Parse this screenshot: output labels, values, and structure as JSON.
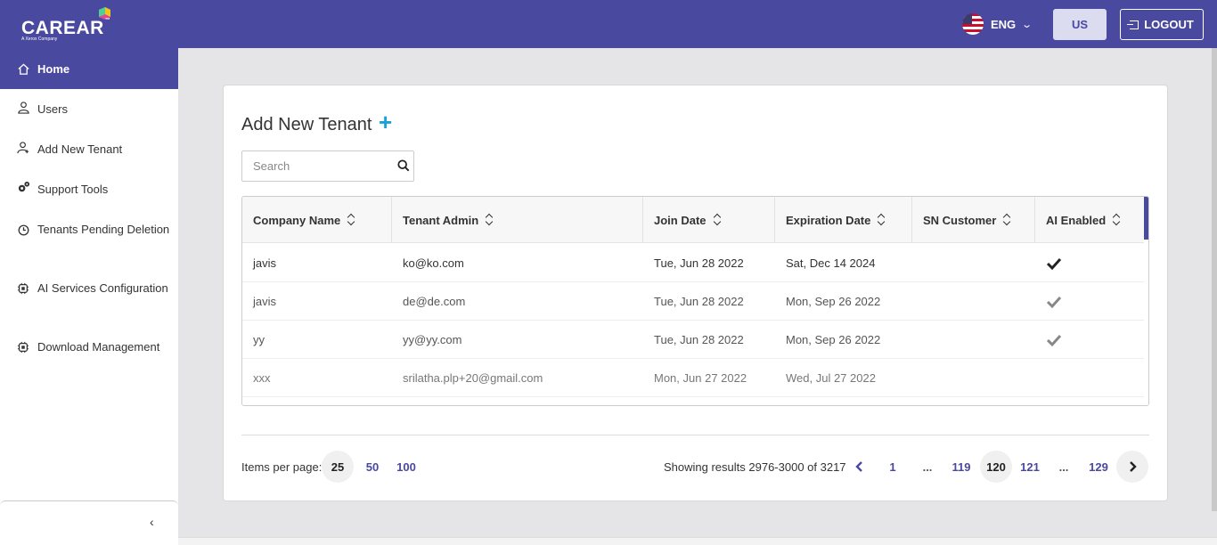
{
  "brand": {
    "name": "CAREAR",
    "tm": "™",
    "sub": "A Xerox Company"
  },
  "header": {
    "language": "ENG",
    "user_button": "US",
    "logout_label": "LOGOUT"
  },
  "sidebar": {
    "items": [
      {
        "label": "Home",
        "icon": "home-icon",
        "active": true
      },
      {
        "label": "Users",
        "icon": "user-icon"
      },
      {
        "label": "Add New Tenant",
        "icon": "user-add-icon"
      },
      {
        "label": "Support Tools",
        "icon": "gears-icon"
      },
      {
        "label": "Tenants Pending Deletion",
        "icon": "clock-icon"
      },
      {
        "label": "AI Services Configuration",
        "icon": "chip-icon"
      },
      {
        "label": "Download Management",
        "icon": "chip-icon"
      }
    ],
    "collapse_glyph": "‹"
  },
  "main": {
    "title": "Add New Tenant",
    "add_glyph": "+",
    "search_placeholder": "Search",
    "table": {
      "columns": [
        "Company Name",
        "Tenant Admin",
        "Join Date",
        "Expiration Date",
        "SN Customer",
        "AI Enabled"
      ],
      "rows": [
        {
          "company": "javis",
          "admin": "ko@ko.com",
          "join": "Tue, Jun 28 2022",
          "expiration": "Sat, Dec 14 2024",
          "sn": "",
          "ai": true
        },
        {
          "company": "javis",
          "admin": "de@de.com",
          "join": "Tue, Jun 28 2022",
          "expiration": "Mon, Sep 26 2022",
          "sn": "",
          "ai": true
        },
        {
          "company": "yy",
          "admin": "yy@yy.com",
          "join": "Tue, Jun 28 2022",
          "expiration": "Mon, Sep 26 2022",
          "sn": "",
          "ai": true
        },
        {
          "company": "xxx",
          "admin": "srilatha.plp+20@gmail.com",
          "join": "Mon, Jun 27 2022",
          "expiration": "Wed, Jul 27 2022",
          "sn": "",
          "ai": false
        }
      ]
    },
    "pagination": {
      "items_per_page_label": "Items per page:",
      "page_sizes": [
        "25",
        "50",
        "100"
      ],
      "selected_page_size": "25",
      "showing": "Showing results 2976-3000 of 3217",
      "pages": [
        "1",
        "...",
        "119",
        "120",
        "121",
        "...",
        "129"
      ],
      "current_page": "120"
    }
  },
  "colors": {
    "brand": "#4a49a0",
    "accent": "#1aa1d6"
  }
}
